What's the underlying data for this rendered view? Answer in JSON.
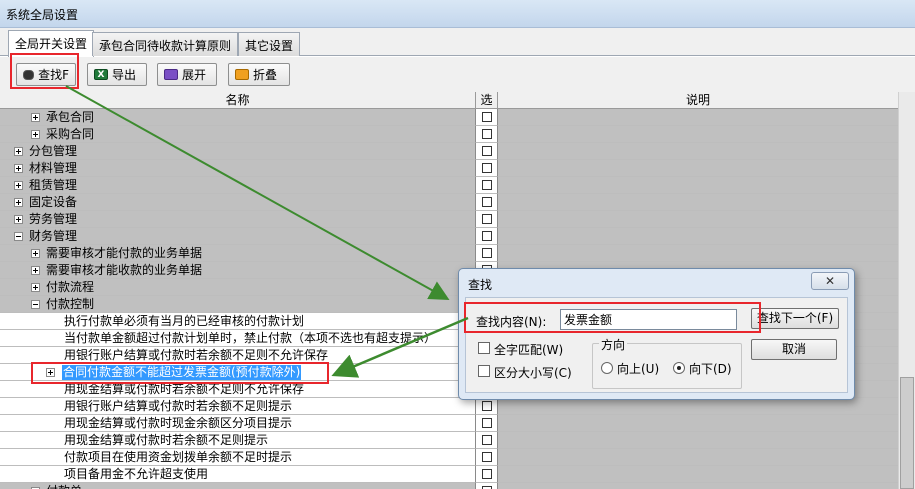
{
  "window": {
    "title": "系统全局设置"
  },
  "tabs": [
    {
      "label": "全局开关设置",
      "active": true
    },
    {
      "label": "承包合同待收款计算原则",
      "active": false
    },
    {
      "label": "其它设置",
      "active": false
    }
  ],
  "toolbar": {
    "find_label": "查找F",
    "export_label": "导出",
    "expand_label": "展开",
    "fold_label": "折叠"
  },
  "grid": {
    "columns": {
      "name": "名称",
      "select": "选",
      "desc": "说明"
    },
    "rows": [
      {
        "label": "承包合同",
        "level": 1,
        "expander": "plus",
        "grey": true
      },
      {
        "label": "采购合同",
        "level": 1,
        "expander": "plus",
        "grey": true
      },
      {
        "label": "分包管理",
        "level": 0,
        "expander": "plus",
        "grey": true
      },
      {
        "label": "材料管理",
        "level": 0,
        "expander": "plus",
        "grey": true
      },
      {
        "label": "租赁管理",
        "level": 0,
        "expander": "plus",
        "grey": true
      },
      {
        "label": "固定设备",
        "level": 0,
        "expander": "plus",
        "grey": true
      },
      {
        "label": "劳务管理",
        "level": 0,
        "expander": "plus",
        "grey": true
      },
      {
        "label": "财务管理",
        "level": 0,
        "expander": "minus",
        "grey": true
      },
      {
        "label": "需要审核才能付款的业务单据",
        "level": 1,
        "expander": "plus",
        "grey": true
      },
      {
        "label": "需要审核才能收款的业务单据",
        "level": 1,
        "expander": "plus",
        "grey": true
      },
      {
        "label": "付款流程",
        "level": 1,
        "expander": "plus",
        "grey": true
      },
      {
        "label": "付款控制",
        "level": 1,
        "expander": "minus",
        "grey": true
      },
      {
        "label": "执行付款单必须有当月的已经审核的付款计划",
        "level": 2,
        "expander": "none",
        "grey": false
      },
      {
        "label": "当付款单金额超过付款计划单时，禁止付款（本项不选也有超支提示）",
        "level": 2,
        "expander": "none",
        "grey": false
      },
      {
        "label": "用银行账户结算或付款时若余额不足则不允许保存",
        "level": 2,
        "expander": "none",
        "grey": false
      },
      {
        "label": "合同付款金额不能超过发票金额(预付款除外)",
        "level": 2,
        "expander": "plus",
        "grey": false,
        "selected": true
      },
      {
        "label": "用现金结算或付款时若余额不足则不允许保存",
        "level": 2,
        "expander": "none",
        "grey": false
      },
      {
        "label": "用银行账户结算或付款时若余额不足则提示",
        "level": 2,
        "expander": "none",
        "grey": false
      },
      {
        "label": "用现金结算或付款时现金余额区分项目提示",
        "level": 2,
        "expander": "none",
        "grey": false
      },
      {
        "label": "用现金结算或付款时若余额不足则提示",
        "level": 2,
        "expander": "none",
        "grey": false
      },
      {
        "label": "付款项目在使用资金划拨单余额不足时提示",
        "level": 2,
        "expander": "none",
        "grey": false
      },
      {
        "label": "项目备用金不允许超支使用",
        "level": 2,
        "expander": "none",
        "grey": false
      },
      {
        "label": "付款单",
        "level": 1,
        "expander": "plus",
        "grey": true
      }
    ]
  },
  "find_dialog": {
    "title": "查找",
    "close_glyph": "✕",
    "content_label": "查找内容(N):",
    "content_value": "发票金额",
    "whole_word_label": "全字匹配(W)",
    "match_case_label": "区分大小写(C)",
    "direction_label": "方向",
    "up_label": "向上(U)",
    "down_label": "向下(D)",
    "find_next_label": "查找下一个(F)",
    "cancel_label": "取消"
  },
  "colors": {
    "annotation_red": "#e8262c",
    "annotation_green": "#3d8b2f",
    "selection_blue": "#3399ff",
    "disabled_grey": "#c0c0c0"
  }
}
